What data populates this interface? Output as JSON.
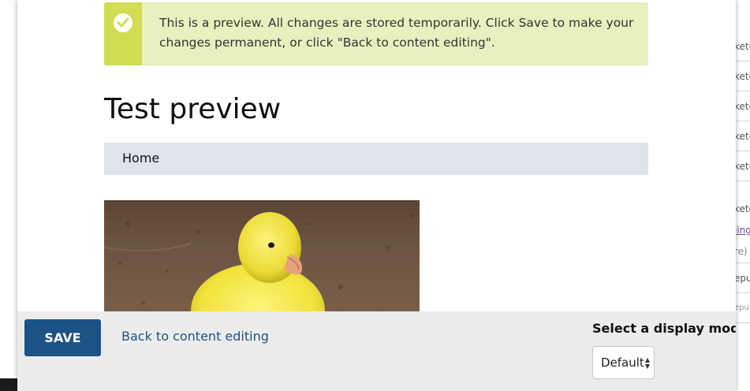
{
  "background_page": {
    "rows": [
      "kete",
      "kete",
      "kete",
      "kete",
      "kete",
      "kete",
      "kete"
    ],
    "link_text": "ling",
    "muted_text": "re)",
    "rows_bottom": [
      "epu",
      "epu"
    ]
  },
  "message": {
    "text": "This is a preview. All changes are stored temporarily. Click Save to make your changes permanent, or click \"Back to content editing\".",
    "icon": "check-circle-icon",
    "accent": "#d1dd53",
    "background": "#e9efbf"
  },
  "page": {
    "title": "Test preview",
    "breadcrumb": [
      "Home"
    ]
  },
  "image": {
    "description_icon": "duckling-photo"
  },
  "actions": {
    "save_label": "SAVE",
    "back_label": "Back to content editing",
    "display_mode_label": "Select a display mode",
    "display_mode_value": "Default",
    "accent": "#1d5287"
  }
}
